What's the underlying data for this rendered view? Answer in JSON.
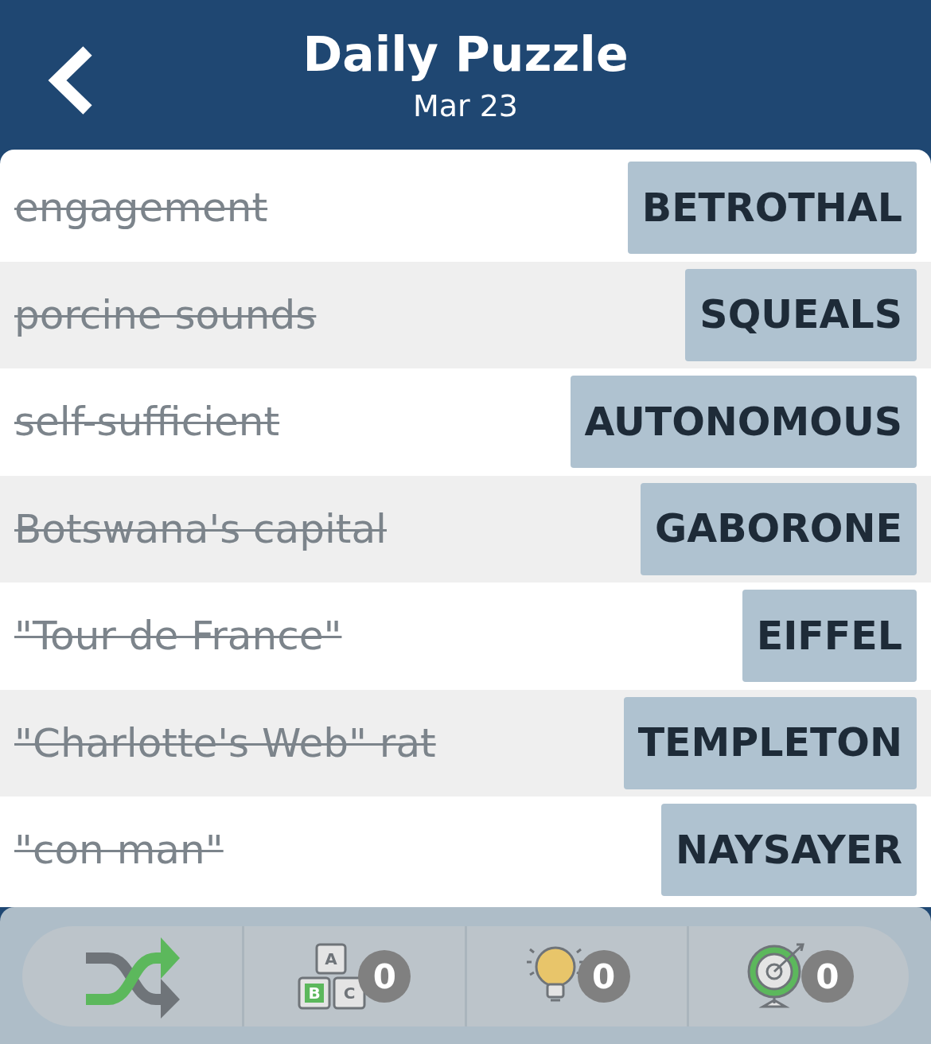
{
  "header": {
    "title": "Daily Puzzle",
    "date": "Mar 23"
  },
  "clues": [
    {
      "clue": "engagement",
      "answer": "BETROTHAL",
      "solved": true
    },
    {
      "clue": "porcine sounds",
      "answer": "SQUEALS",
      "solved": true
    },
    {
      "clue": "self-sufficient",
      "answer": "AUTONOMOUS",
      "solved": true
    },
    {
      "clue": "Botswana's capital",
      "answer": "GABORONE",
      "solved": true
    },
    {
      "clue": "\"Tour de France\"",
      "answer": "EIFFEL",
      "solved": true
    },
    {
      "clue": "\"Charlotte's Web\" rat",
      "answer": "TEMPLETON",
      "solved": true
    },
    {
      "clue": "\"con man\"",
      "answer": "NAYSAYER",
      "solved": true
    }
  ],
  "toolbar": [
    {
      "kind": "shuffle"
    },
    {
      "kind": "letters",
      "blocks": [
        "A",
        "B",
        "C"
      ],
      "count": "0"
    },
    {
      "kind": "hint",
      "count": "0"
    },
    {
      "kind": "target",
      "count": "0"
    }
  ]
}
